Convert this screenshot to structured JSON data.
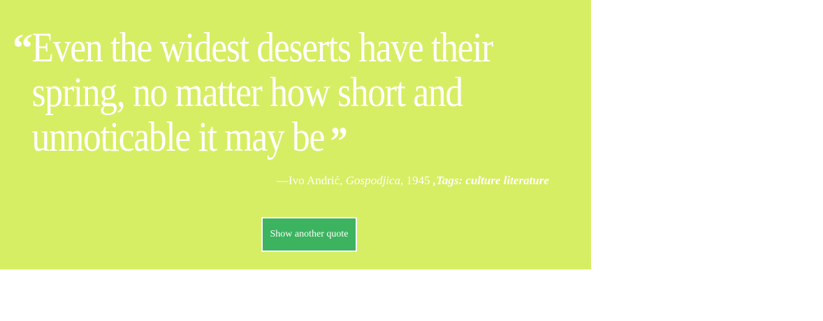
{
  "quote": {
    "open_mark": "“",
    "text": "Even the widest deserts have their spring, no matter how short and unnoticable it may be",
    "close_mark": "”"
  },
  "attribution": {
    "dash_author": "—Ivo Andrić, ",
    "work": "Gospodjica",
    "year": ", 1945 ",
    "tags_label": ",Tags: culture literature"
  },
  "actions": {
    "show_another_label": "Show another quote"
  },
  "colors": {
    "panel_background": "#d6ee63",
    "button_background": "#3cb35f",
    "text": "#ffffff"
  }
}
